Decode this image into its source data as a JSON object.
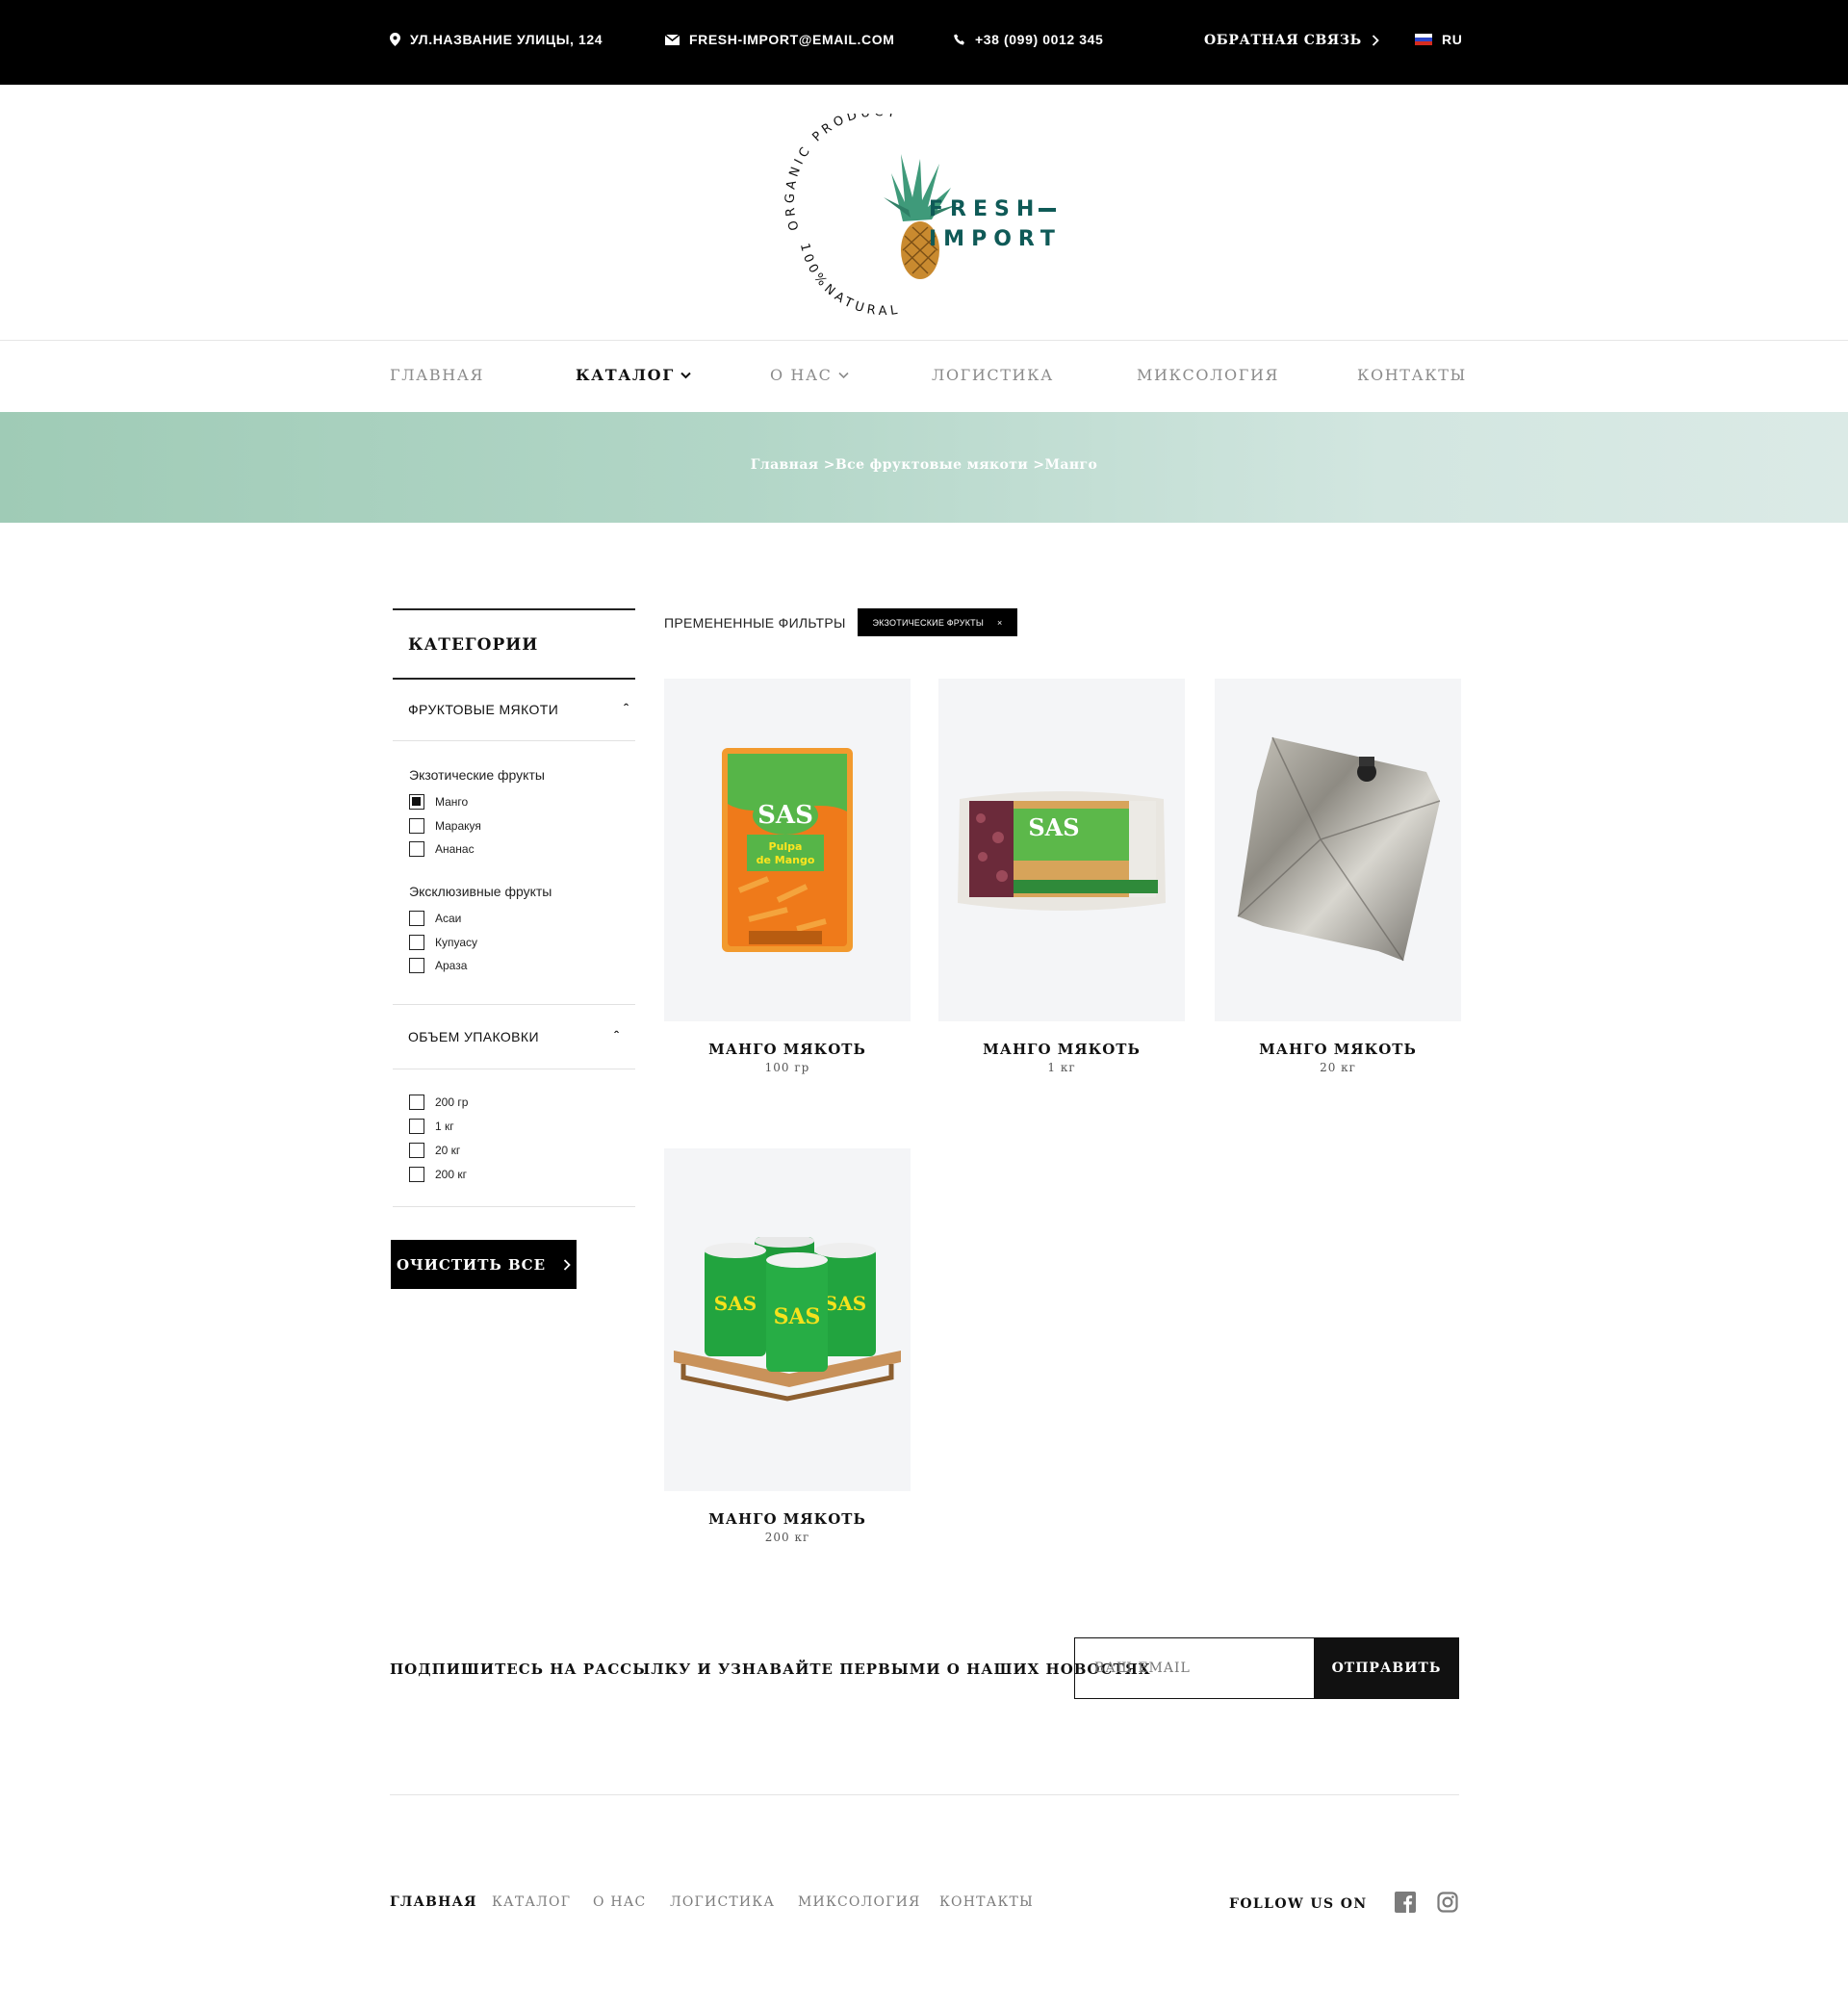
{
  "topbar": {
    "address": "УЛ.НАЗВАНИЕ УЛИЦЫ, 124",
    "email": "FRESH-IMPORT@EMAIL.COM",
    "phone": "+38 (099) 0012 345",
    "feedback": "ОБРАТНАЯ СВЯЗЬ",
    "language": "RU"
  },
  "logo": {
    "ring_top": "ORGANIC PRODUCT",
    "ring_bottom": "100%NATURAL",
    "line1": "FRESH",
    "line2": "IMPORT"
  },
  "nav": {
    "items": [
      {
        "label": "ГЛАВНАЯ"
      },
      {
        "label": "КАТАЛОГ"
      },
      {
        "label": "О НАС"
      },
      {
        "label": "ЛОГИСТИКА"
      },
      {
        "label": "МИКСОЛОГИЯ"
      },
      {
        "label": "КОНТАКТЫ"
      }
    ],
    "active": "КАТАЛОГ"
  },
  "breadcrumb": "Главная >Все фруктовые мякоти >Манго",
  "sidebar": {
    "title": "КАТЕГОРИИ",
    "section1": {
      "title": "ФРУКТОВЫЕ МЯКОТИ",
      "groups": [
        {
          "title": "Экзотические фрукты",
          "items": [
            {
              "label": "Манго",
              "checked": true
            },
            {
              "label": "Маракуя",
              "checked": false
            },
            {
              "label": "Ананас",
              "checked": false
            }
          ]
        },
        {
          "title": "Эксклюзивные фрукты",
          "items": [
            {
              "label": "Асаи",
              "checked": false
            },
            {
              "label": "Купуасу",
              "checked": false
            },
            {
              "label": "Араза",
              "checked": false
            }
          ]
        }
      ]
    },
    "section2": {
      "title": "ОБЪЕМ УПАКОВКИ",
      "items": [
        {
          "label": "200 гр",
          "checked": false
        },
        {
          "label": "1 кг",
          "checked": false
        },
        {
          "label": "20 кг",
          "checked": false
        },
        {
          "label": "200 кг",
          "checked": false
        }
      ]
    },
    "clear_button": "ОЧИСТИТЬ ВСЕ"
  },
  "filters": {
    "label": "ПРЕМЕНЕННЫЕ ФИЛЬТРЫ",
    "chip": "ЭКЗОТИЧЕСКИЕ ФРУКТЫ",
    "chip_close": "×"
  },
  "products": [
    {
      "name": "МАНГО МЯКОТЬ",
      "size": "100 гр",
      "image": "orange-pouch"
    },
    {
      "name": "МАНГО МЯКОТЬ",
      "size": "1 кг",
      "image": "wide-pack"
    },
    {
      "name": "МАНГО МЯКОТЬ",
      "size": "20 кг",
      "image": "foil-bag"
    },
    {
      "name": "МАНГО МЯКОТЬ",
      "size": "200 кг",
      "image": "green-barrels"
    }
  ],
  "newsletter": {
    "text": "ПОДПИШИТЕСЬ НА РАССЫЛКУ И УЗНАВАЙТЕ ПЕРВЫМИ О НАШИХ НОВОСТЯХ",
    "placeholder": "ВАШ EMAIL",
    "button": "ОТПРАВИТЬ"
  },
  "footer": {
    "nav": [
      {
        "label": "ГЛАВНАЯ"
      },
      {
        "label": "КАТАЛОГ"
      },
      {
        "label": "О НАС"
      },
      {
        "label": "ЛОГИСТИКА"
      },
      {
        "label": "МИКСОЛОГИЯ"
      },
      {
        "label": "КОНТАКТЫ"
      }
    ],
    "follow": "FOLLOW US ON",
    "social": [
      "facebook-icon",
      "instagram-icon"
    ]
  },
  "colors": {
    "brand_green": "#0f5a57",
    "hero_start": "#9fcbb6",
    "hero_end": "#dbeae6",
    "dark": "#000000",
    "card_bg": "#f4f5f7"
  }
}
